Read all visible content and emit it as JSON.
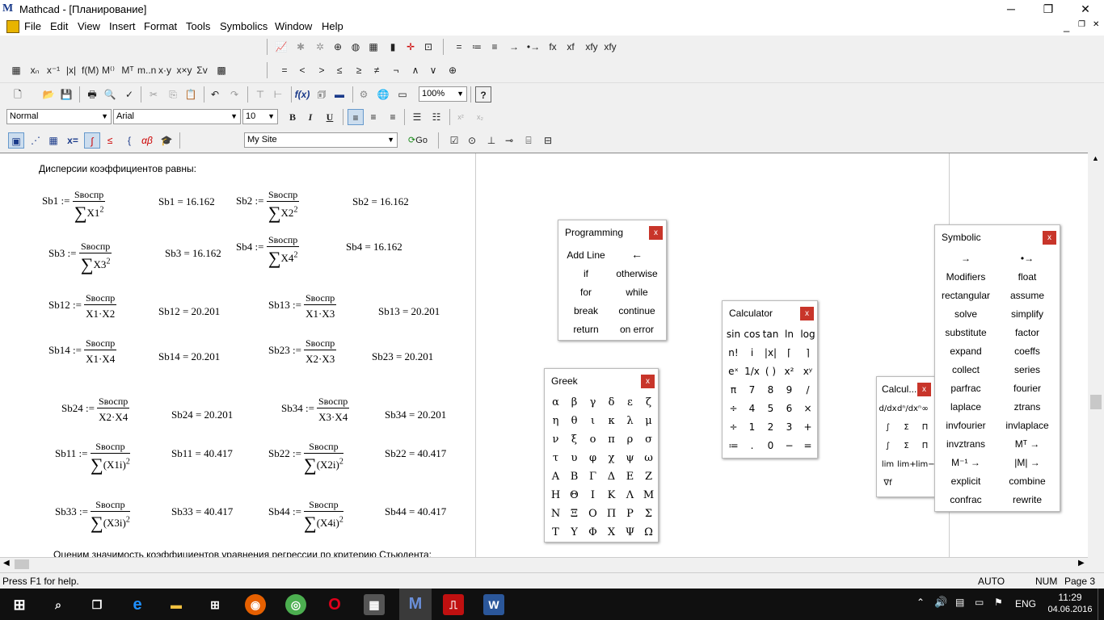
{
  "window": {
    "title": "Mathcad - [Планирование]",
    "app_letter": "M",
    "min": "─",
    "max": "❐",
    "close": "✕"
  },
  "menu": {
    "items": [
      "File",
      "Edit",
      "View",
      "Insert",
      "Format",
      "Tools",
      "Symbolics",
      "Window",
      "Help"
    ],
    "doc_min": "_",
    "doc_restore": "❐",
    "doc_close": "✕"
  },
  "toolbar": {
    "style_value": "Normal",
    "font_value": "Arial",
    "size_value": "10",
    "zoom_value": "100%",
    "site_value": "My Site",
    "go_label": "Go",
    "bold": "B",
    "italic": "I",
    "underline": "U",
    "eval_symbols": [
      "=",
      "≔",
      "≡",
      "→",
      "•→",
      "fx",
      "xf",
      "xfy",
      "xfy"
    ],
    "bool_symbols": [
      "=",
      "<",
      ">",
      "≤",
      "≥",
      "≠",
      "¬",
      "∧",
      "∨",
      "⊕"
    ]
  },
  "worksheet": {
    "heading": "Дисперсии коэффициентов равны:",
    "footer_line": "Оценим значимость коэффициентов уравнения регрессии по критерию Стьюдента:",
    "numerator": "Sвоспр",
    "defs": [
      {
        "name": "Sb1",
        "den": "X1",
        "result": "Sb1 = 16.162"
      },
      {
        "name": "Sb2",
        "den": "X2",
        "result": "Sb2 = 16.162"
      },
      {
        "name": "Sb3",
        "den": "X3",
        "result": "Sb3 = 16.162"
      },
      {
        "name": "Sb4",
        "den": "X4",
        "result": "Sb4 = 16.162"
      },
      {
        "name": "Sb12",
        "den": "X1·X2",
        "result": "Sb12 = 20.201"
      },
      {
        "name": "Sb13",
        "den": "X1·X3",
        "result": "Sb13 = 20.201"
      },
      {
        "name": "Sb14",
        "den": "X1·X4",
        "result": "Sb14 = 20.201"
      },
      {
        "name": "Sb23",
        "den": "X2·X3",
        "result": "Sb23 = 20.201"
      },
      {
        "name": "Sb24",
        "den": "X2·X4",
        "result": "Sb24 = 20.201"
      },
      {
        "name": "Sb34",
        "den": "X3·X4",
        "result": "Sb34 = 20.201"
      },
      {
        "name": "Sb11",
        "den": "(X1i)",
        "result": "Sb11 = 40.417"
      },
      {
        "name": "Sb22",
        "den": "(X2i)",
        "result": "Sb22 = 40.417"
      },
      {
        "name": "Sb33",
        "den": "(X3i)",
        "result": "Sb33 = 40.417"
      },
      {
        "name": "Sb44",
        "den": "(X4i)",
        "result": "Sb44 = 40.417"
      }
    ]
  },
  "programming": {
    "title": "Programming",
    "close": "x",
    "items": [
      "Add Line",
      "←",
      "if",
      "otherwise",
      "for",
      "while",
      "break",
      "continue",
      "return",
      "on error"
    ]
  },
  "calculator": {
    "title": "Calculator",
    "close": "x",
    "items": [
      "sin",
      "cos",
      "tan",
      "ln",
      "log",
      "n!",
      "i",
      "|x|",
      "⌈",
      "⌉",
      "eˣ",
      "1/x",
      "( )",
      "x²",
      "xʸ",
      "π",
      "7",
      "8",
      "9",
      "/",
      "÷",
      "4",
      "5",
      "6",
      "×",
      "÷",
      "1",
      "2",
      "3",
      "+",
      "≔",
      ".",
      "0",
      "−",
      "="
    ]
  },
  "greek": {
    "title": "Greek",
    "close": "x",
    "items": [
      "α",
      "β",
      "γ",
      "δ",
      "ε",
      "ζ",
      "η",
      "θ",
      "ι",
      "κ",
      "λ",
      "μ",
      "ν",
      "ξ",
      "ο",
      "π",
      "ρ",
      "σ",
      "τ",
      "υ",
      "φ",
      "χ",
      "ψ",
      "ω",
      "Α",
      "Β",
      "Γ",
      "Δ",
      "Ε",
      "Ζ",
      "Η",
      "Θ",
      "Ι",
      "Κ",
      "Λ",
      "Μ",
      "Ν",
      "Ξ",
      "Ο",
      "Π",
      "Ρ",
      "Σ",
      "Τ",
      "Υ",
      "Φ",
      "Χ",
      "Ψ",
      "Ω"
    ]
  },
  "calculus": {
    "title": "Calcul...",
    "close": "x",
    "items": [
      "d/dx",
      "dⁿ/dxⁿ",
      "∞",
      "∫",
      "Σ",
      "Π",
      "∫",
      "Σ",
      "Π",
      "lim",
      "lim+",
      "lim−",
      "∇f"
    ]
  },
  "symbolic": {
    "title": "Symbolic",
    "close": "x",
    "items": [
      "→",
      "•→",
      "Modifiers",
      "float",
      "rectangular",
      "assume",
      "solve",
      "simplify",
      "substitute",
      "factor",
      "expand",
      "coeffs",
      "collect",
      "series",
      "parfrac",
      "fourier",
      "laplace",
      "ztrans",
      "invfourier",
      "invlaplace",
      "invztrans",
      "Mᵀ →",
      "M⁻¹ →",
      "|M| →",
      "explicit",
      "combine",
      "confrac",
      "rewrite"
    ]
  },
  "status": {
    "help": "Press F1 for help.",
    "auto": "AUTO",
    "num": "NUM",
    "page": "Page 3"
  },
  "taskbar": {
    "time": "11:29",
    "date": "04.06.2016",
    "lang": "ENG"
  }
}
